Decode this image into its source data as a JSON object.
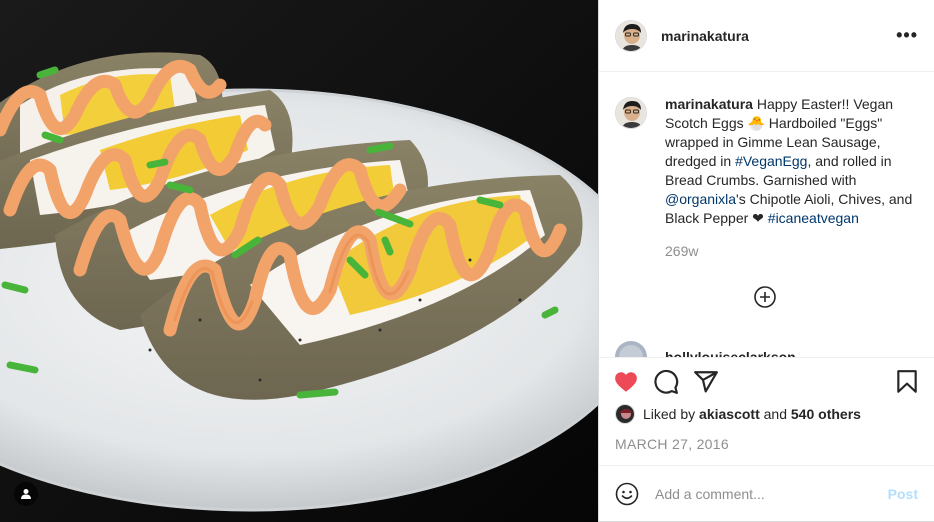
{
  "post": {
    "username": "marinakatura",
    "more_label": "•••",
    "caption": {
      "username": "marinakatura",
      "part1": " Happy Easter!! Vegan Scotch Eggs 🐣 Hardboiled \"Eggs\" wrapped in Gimme Lean Sausage, dredged in ",
      "tag1": "#VeganEgg",
      "part2": ", and rolled in Bread Crumbs. Garnished with ",
      "mention": "@organixla",
      "part3": "'s Chipotle Aioli, Chives, and Black Pepper ❤ ",
      "tag2": "#icaneatvegan",
      "time": "269w"
    },
    "next_comment_user": "hollylouiseclarkson",
    "likes": {
      "prefix": "Liked by ",
      "user": "akiascott",
      "middle": " and ",
      "others": "540 others"
    },
    "date": "MARCH 27, 2016",
    "comment_placeholder": "Add a comment...",
    "post_label": "Post"
  },
  "icons": [
    "heart-icon",
    "comment-icon",
    "share-icon",
    "bookmark-icon",
    "emoji-icon",
    "plus-circle-icon",
    "user-tag-icon",
    "more-icon"
  ],
  "colors": {
    "liked_heart": "#ed4956",
    "link": "#00376b",
    "muted": "#8e8e8e",
    "post_disabled": "#b2dffc"
  }
}
